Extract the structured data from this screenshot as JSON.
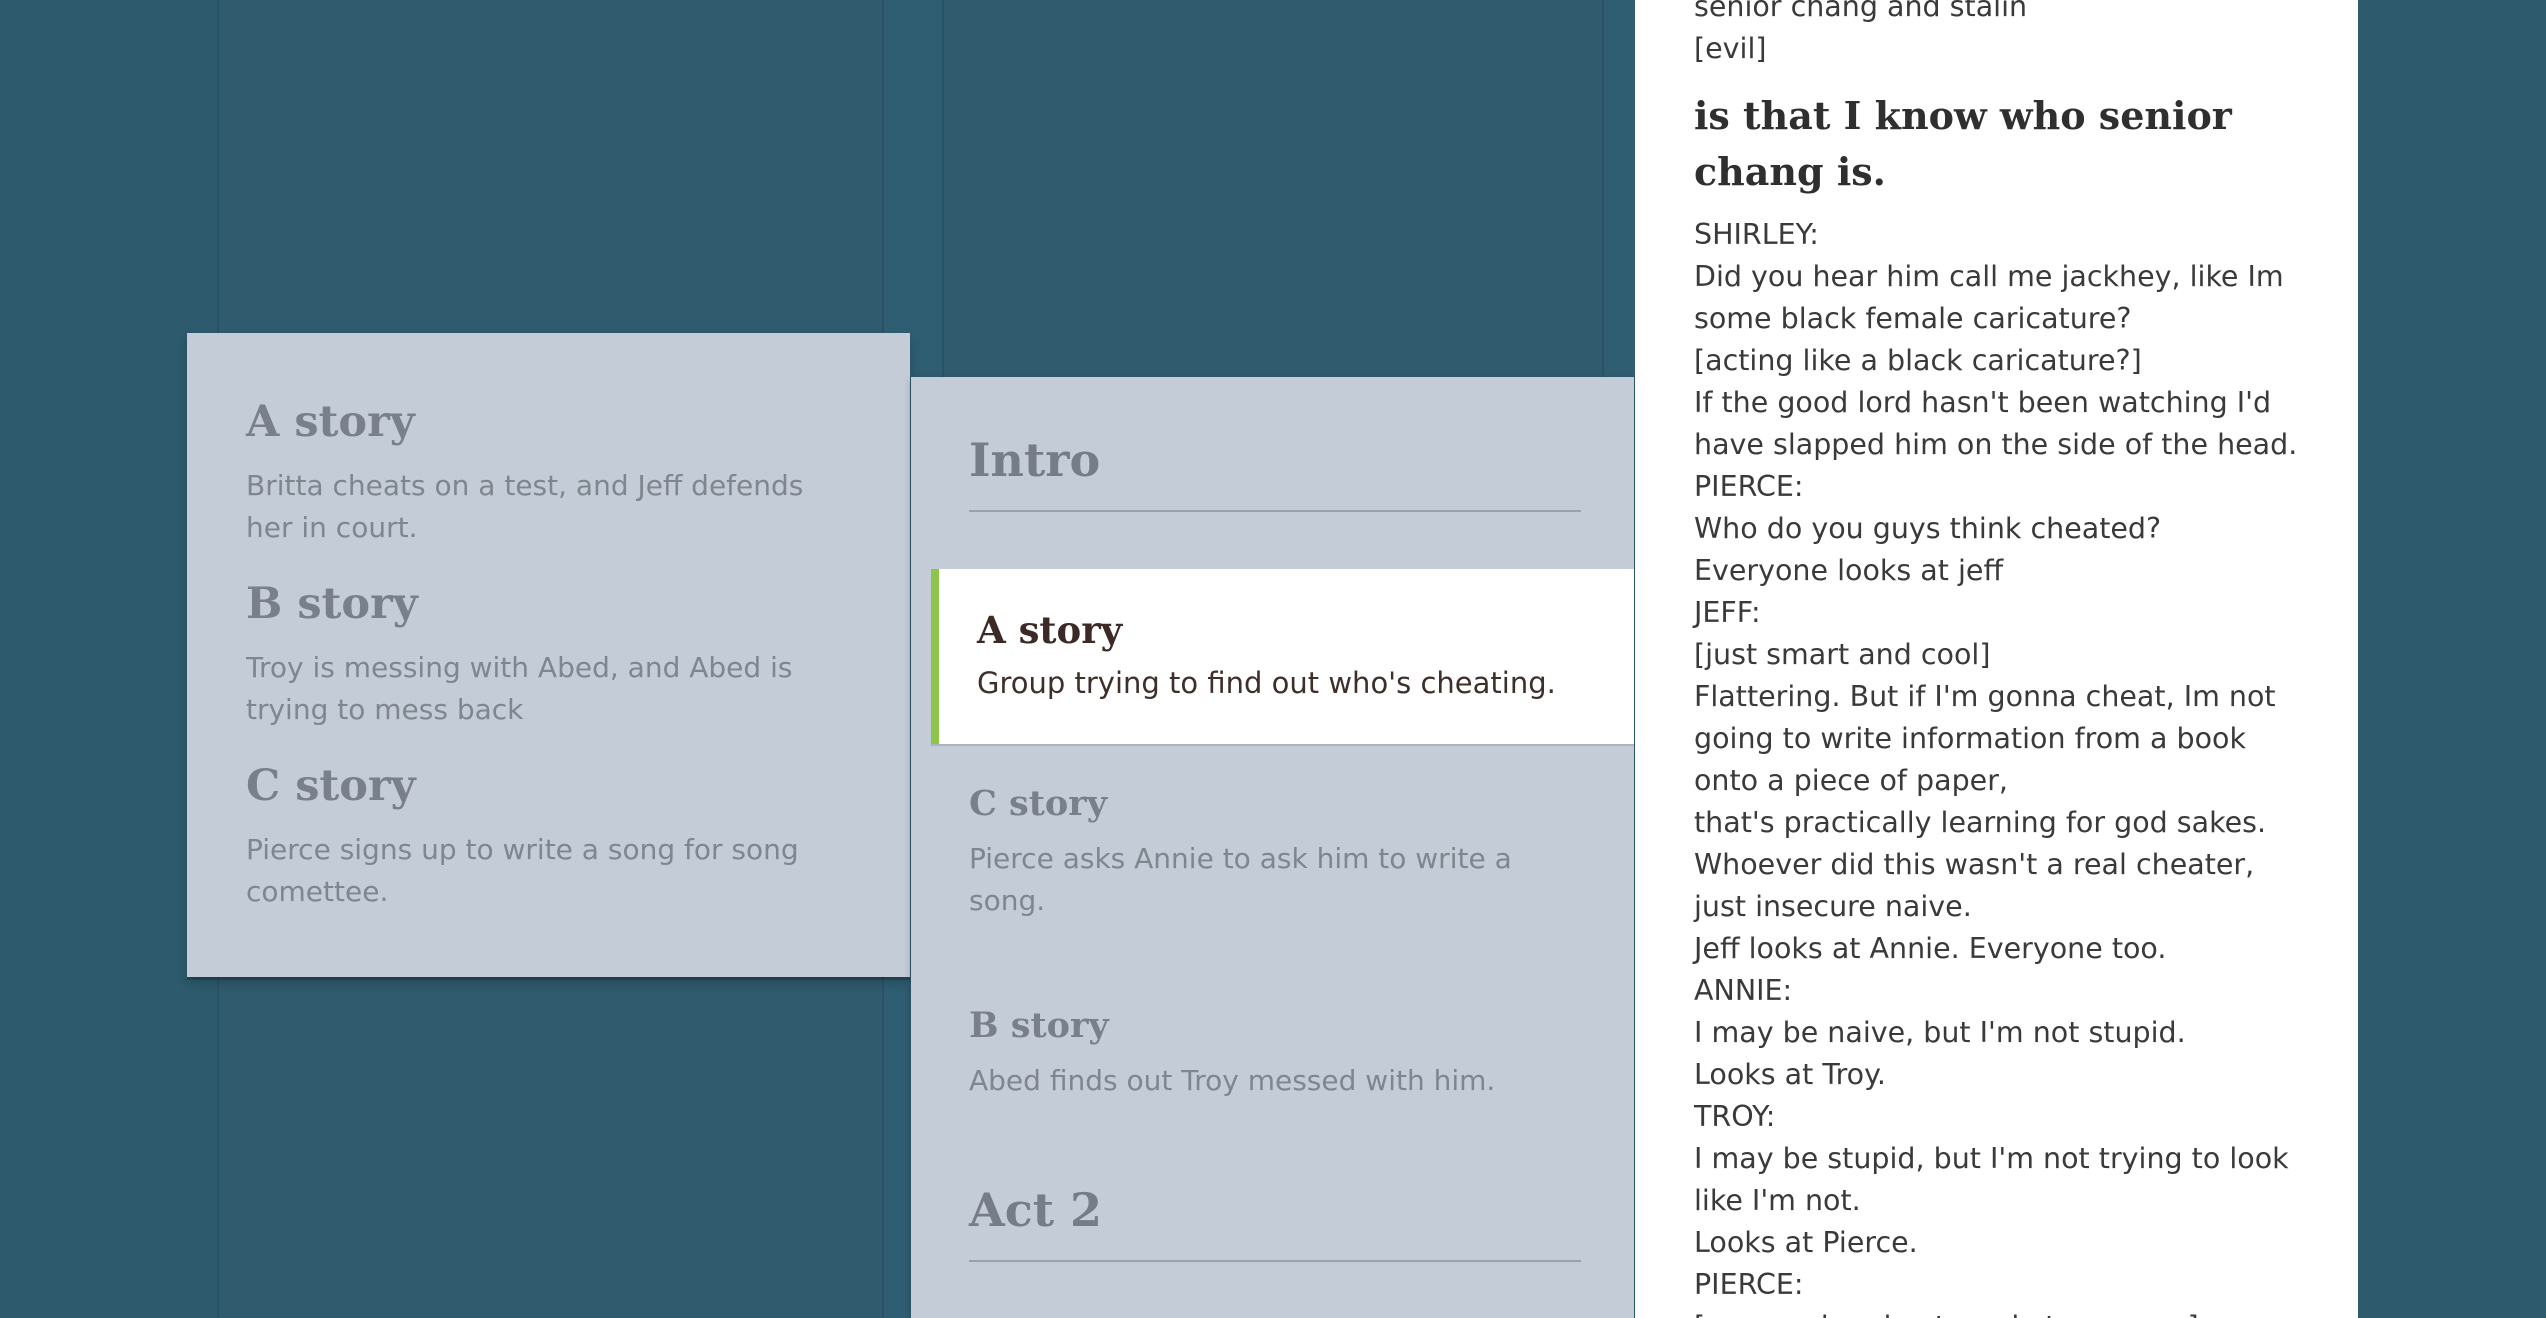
{
  "outline": {
    "items": [
      {
        "title": "A story",
        "description": "Britta cheats on a test, and Jeff defends her in court."
      },
      {
        "title": "B story",
        "description": "Troy is messing with Abed, and Abed is trying to mess back"
      },
      {
        "title": "C story",
        "description": "Pierce signs up to write a song for song comettee."
      }
    ]
  },
  "scenes": {
    "intro_heading": "Intro",
    "selected": {
      "title": "A story",
      "description": "Group trying to find out who's cheating."
    },
    "c_story": {
      "title": "C story",
      "description": "Pierce asks Annie to ask him to write a song."
    },
    "b_story": {
      "title": "B story",
      "description": "Abed finds out Troy messed with him."
    },
    "act2_heading": "Act 2"
  },
  "script": {
    "pre_lines": [
      "senior chang and stalin",
      "[evil]"
    ],
    "heading": "is that I know who senior chang is.",
    "lines": [
      "SHIRLEY:",
      "Did you hear him call me jackhey, like Im some black female caricature?",
      "[acting like a black caricature?]",
      "If the good lord hasn't been watching I'd have slapped him on the side of the head.",
      "PIERCE:",
      "Who do you guys think cheated?",
      "Everyone looks at jeff",
      "JEFF:",
      "[just smart and cool]",
      "Flattering. But if I'm gonna cheat, Im not going to write information from a book onto a piece of paper,",
      "that's practically learning for god sakes.",
      "Whoever did this wasn't a real cheater, just insecure naive.",
      "Jeff looks at Annie. Everyone too.",
      "ANNIE:",
      "I may be naive, but I'm not stupid.",
      "Looks at Troy.",
      "TROY:",
      "I may be stupid, but I'm not trying to look like I'm not.",
      "Looks at Pierce.",
      "PIERCE:",
      "[annoyed and yet ready to pounce]"
    ]
  },
  "colors": {
    "background": "#2e5a6e",
    "card": "#c4ccd7",
    "accent": "#8dc44a"
  }
}
